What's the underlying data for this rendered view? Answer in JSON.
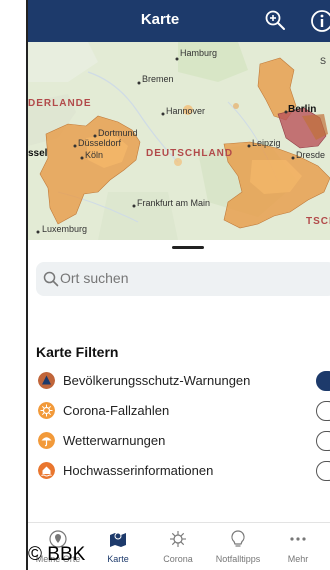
{
  "header": {
    "title": "Karte",
    "zoom_icon": "zoom-in-icon",
    "info_icon": "info-icon"
  },
  "map": {
    "cities": {
      "hamburg": "Hamburg",
      "bremen": "Bremen",
      "hannover": "Hannover",
      "berlin": "Berlin",
      "dortmund": "Dortmund",
      "duesseldorf": "Düsseldorf",
      "koeln": "Köln",
      "leipzig": "Leipzig",
      "dresden": "Dresde",
      "frankfurt": "Frankfurt am Main",
      "luxemburg": "Luxemburg",
      "stettin": "S",
      "assel": "ssel"
    },
    "regions": {
      "niederlande": "DERLANDE",
      "deutschland": "DEUTSCHLAND",
      "tschechien": "TSCH"
    },
    "warning_colors": {
      "light": "#f5b86a",
      "medium": "#e8963e",
      "strong": "#c0703b",
      "severe": "#b9545a"
    }
  },
  "sheet": {
    "search_placeholder": "Ort suchen",
    "filter_title": "Karte Filtern",
    "filters": [
      {
        "label": "Bevölkerungsschutz-Warnungen",
        "icon": "warning-triangle-icon",
        "icon_color": "#c0653a",
        "enabled": true
      },
      {
        "label": "Corona-Fallzahlen",
        "icon": "virus-icon",
        "icon_color": "#f29a3a",
        "enabled": false
      },
      {
        "label": "Wetterwarnungen",
        "icon": "umbrella-icon",
        "icon_color": "#f29a3a",
        "enabled": false
      },
      {
        "label": "Hochwasserinformationen",
        "icon": "flood-house-icon",
        "icon_color": "#e9762e",
        "enabled": false
      }
    ]
  },
  "tabbar": {
    "tabs": [
      {
        "label": "Meine Orte",
        "icon": "location-pin-icon",
        "active": false
      },
      {
        "label": "Karte",
        "icon": "map-icon",
        "active": true
      },
      {
        "label": "Corona",
        "icon": "virus-icon",
        "active": false
      },
      {
        "label": "Notfalltipps",
        "icon": "lightbulb-icon",
        "active": false
      },
      {
        "label": "Mehr",
        "icon": "more-icon",
        "active": false
      }
    ]
  },
  "copyright": "© BBK",
  "colors": {
    "header_bg": "#1d3a6b",
    "accent": "#1d3a6b",
    "search_bg": "#eef1f3"
  }
}
